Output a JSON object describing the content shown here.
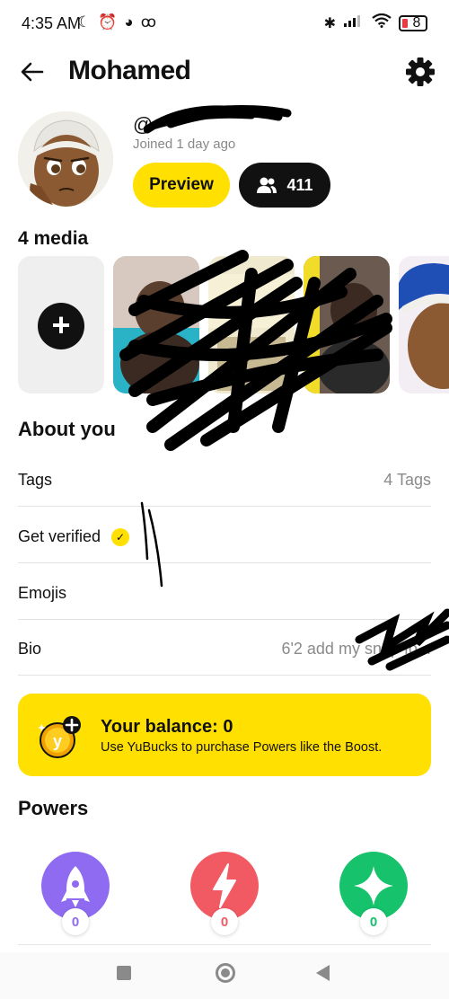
{
  "status_bar": {
    "time": "4:35 AM",
    "battery": "8",
    "left_icons": [
      "moon-icon",
      "alarm-icon",
      "app-icon",
      "voicemail-icon"
    ],
    "right_icons": [
      "bluetooth-icon",
      "signal-icon",
      "wifi-icon",
      "battery-icon"
    ]
  },
  "header": {
    "title": "Mohamed",
    "back_icon": "back-arrow-icon",
    "settings_icon": "gear-icon"
  },
  "profile": {
    "handle_prefix": "@",
    "joined": "Joined 1 day ago",
    "preview_label": "Preview",
    "friends_count": "411"
  },
  "media": {
    "title": "4 media",
    "add_icon": "plus-icon"
  },
  "about": {
    "title": "About you",
    "rows": [
      {
        "label": "Tags",
        "value": "4 Tags"
      },
      {
        "label": "Get verified",
        "value": ""
      },
      {
        "label": "Emojis",
        "value": ""
      },
      {
        "label": "Bio",
        "value": "6'2 add my snap fo..."
      }
    ]
  },
  "balance": {
    "title": "Your balance: 0",
    "subtitle": "Use YuBucks to purchase Powers like the Boost."
  },
  "powers": {
    "title": "Powers",
    "items": [
      {
        "icon": "rocket-icon",
        "count": "0",
        "color": "#8e6bf0",
        "count_color": "#8e6bf0"
      },
      {
        "icon": "lightning-icon",
        "count": "0",
        "color": "#f25a63",
        "count_color": "#f25a63"
      },
      {
        "icon": "sparkle-icon",
        "count": "0",
        "color": "#16c26b",
        "count_color": "#16c26b"
      }
    ]
  },
  "colors": {
    "accent_yellow": "#ffe000",
    "dark": "#111111",
    "muted": "#8a8a8a"
  }
}
